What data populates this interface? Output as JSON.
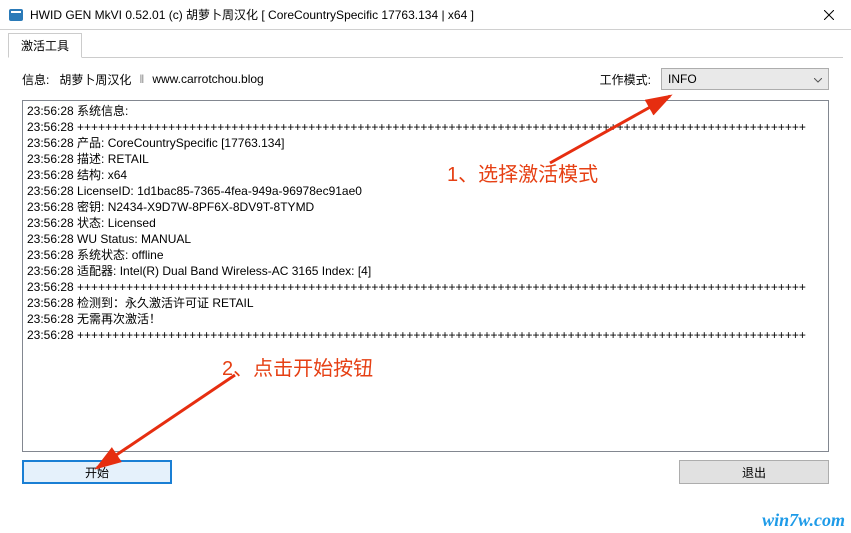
{
  "window": {
    "title": "HWID GEN MkVI 0.52.01 (c) 胡萝卜周汉化 [ CoreCountrySpecific 17763.134 | x64 ]"
  },
  "tabs": {
    "activate": "激活工具"
  },
  "info": {
    "label": "信息:",
    "author": "胡萝卜周汉化",
    "sep": "‖",
    "url": "www.carrotchou.blog"
  },
  "mode": {
    "label": "工作模式:",
    "value": "INFO"
  },
  "log": [
    "23:56:28 系统信息:",
    "23:56:28 ++++++++++++++++++++++++++++++++++++++++++++++++++++++++++++++++++++++++++++++++++++++++++++++++++++++++",
    "23:56:28 产品: CoreCountrySpecific [17763.134]",
    "23:56:28 描述: RETAIL",
    "23:56:28 结构: x64",
    "23:56:28 LicenseID: 1d1bac85-7365-4fea-949a-96978ec91ae0",
    "23:56:28 密钥: N2434-X9D7W-8PF6X-8DV9T-8TYMD",
    "23:56:28 状态: Licensed",
    "23:56:28 WU Status: MANUAL",
    "23:56:28 系统状态: offline",
    "23:56:28 适配器: Intel(R) Dual Band Wireless-AC 3165 Index: [4]",
    "23:56:28 ++++++++++++++++++++++++++++++++++++++++++++++++++++++++++++++++++++++++++++++++++++++++++++++++++++++++",
    "23:56:28 检测到：永久激活许可证 RETAIL",
    "23:56:28 无需再次激活！",
    "23:56:28 ++++++++++++++++++++++++++++++++++++++++++++++++++++++++++++++++++++++++++++++++++++++++++++++++++++++++"
  ],
  "buttons": {
    "start": "开始",
    "exit": "退出"
  },
  "annotations": {
    "a1": "1、选择激活模式",
    "a2": "2、点击开始按钮"
  },
  "watermark": "win7w.com"
}
